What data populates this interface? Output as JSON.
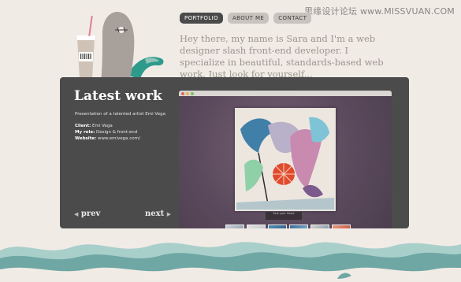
{
  "watermark": "思缘设计论坛  www.MISSVUAN.COM",
  "nav": {
    "tabs": [
      {
        "label": "PORTFOLIO",
        "active": true
      },
      {
        "label": "ABOUT ME",
        "active": false
      },
      {
        "label": "CONTACT",
        "active": false
      }
    ]
  },
  "intro": {
    "text": "Hey there, my name is Sara and I'm a web designer slash front-end developer. I specialize in beautiful, standards-based web work. Just look for yourself..."
  },
  "portfolio": {
    "title": "Latest work",
    "description": "Presentation of a talented artist Emi Vega",
    "meta": [
      {
        "label": "Client:",
        "value": "Emi Vega"
      },
      {
        "label": "My role:",
        "value": "Design & front-end"
      },
      {
        "label": "Website:",
        "value": "www.emivega.com/"
      }
    ],
    "prev_label": "prev",
    "next_label": "next",
    "caption": "Sink your Heart"
  },
  "colors": {
    "background": "#f1ebe6",
    "panel": "#4b4b4b",
    "active_tab": "#4a4a4a",
    "wave_teal": "#6fa7a4",
    "mascot_teal": "#2e9a8c"
  },
  "icons": [
    "mascot-illustration",
    "coffee-cup-icon",
    "chevron-left-icon",
    "chevron-right-icon",
    "bird-icon"
  ]
}
